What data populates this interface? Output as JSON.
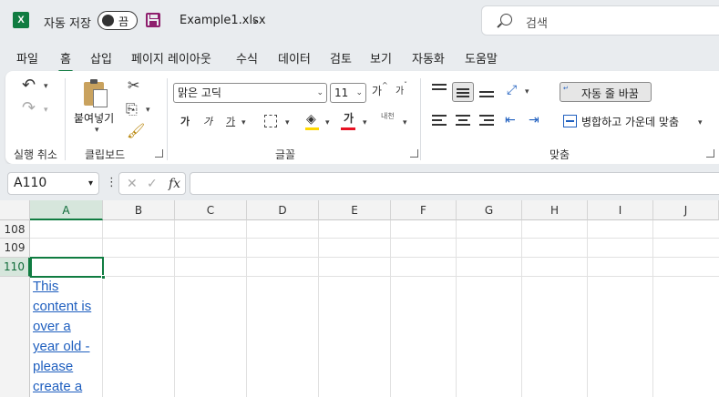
{
  "titlebar": {
    "app_logo": "X",
    "autosave_label": "자동 저장",
    "autosave_state": "끔",
    "filename": "Example1.xlsx",
    "search_placeholder": "검색"
  },
  "menu": {
    "tabs": [
      "파일",
      "홈",
      "삽입",
      "페이지 레이아웃",
      "수식",
      "데이터",
      "검토",
      "보기",
      "자동화",
      "도움말"
    ],
    "active_tab": "홈"
  },
  "ribbon": {
    "undo_group": "실행 취소",
    "clipboard_group": "클립보드",
    "paste_label": "붙여넣기",
    "font_group": "글꼴",
    "font_name": "맑은 고딕",
    "font_size": "11",
    "grow_font": "가",
    "shrink_font": "가",
    "bold": "가",
    "italic": "가",
    "underline": "가",
    "font_color_glyph": "가",
    "phonetic": "내천",
    "alignment_group": "맞춤",
    "wrap_text": "자동 줄 바꿈",
    "merge_center": "병합하고 가운데 맞춤",
    "colors": {
      "accent": "#107c41",
      "font_color": "#e81123",
      "fill_color": "#ffd800"
    }
  },
  "formula_bar": {
    "name_box": "A110",
    "fx_label": "fx",
    "formula_value": ""
  },
  "sheet": {
    "columns": [
      "A",
      "B",
      "C",
      "D",
      "E",
      "F",
      "G",
      "H",
      "I",
      "J"
    ],
    "selected_column": "A",
    "rows": [
      "108",
      "109",
      "110"
    ],
    "selected_row": "110",
    "link_text": "This\ncontent is\nover a\nyear old -\nplease \ncreate a"
  }
}
